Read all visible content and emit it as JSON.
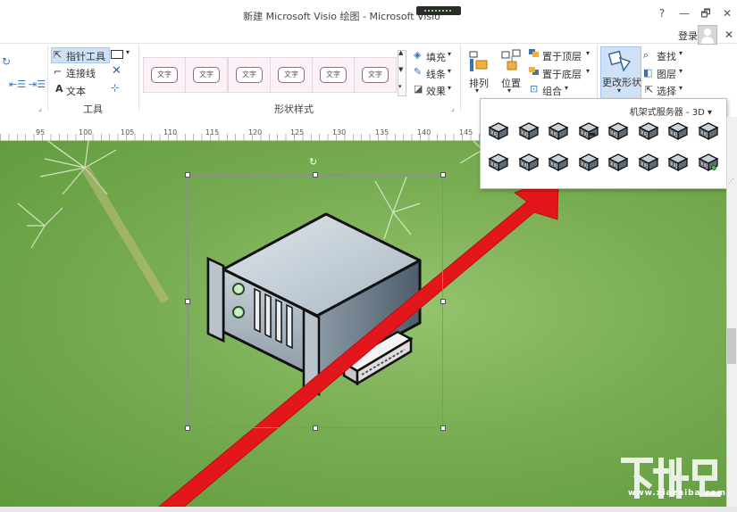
{
  "window": {
    "title": "新建 Microsoft Visio 绘图 - Microsoft Visio",
    "help": "?",
    "minimize": "—",
    "restore": "🗗",
    "close": "✕"
  },
  "account": {
    "login": "登录",
    "ribbon_close": "✕"
  },
  "tools_group": {
    "pointer": "指针工具",
    "connector": "连接线",
    "text": "文本",
    "label": "工具"
  },
  "shape_styles": {
    "label": "形状样式",
    "thumbnails": [
      "文字",
      "文字",
      "文字",
      "文字",
      "文字",
      "文字"
    ],
    "fill": "填充",
    "line": "线条",
    "effect": "效果"
  },
  "arrange": {
    "arrange": "排列",
    "position": "位置",
    "bring_front": "置于顶层",
    "send_back": "置于底层",
    "group": "组合"
  },
  "change_shape": {
    "label": "更改形状"
  },
  "editing": {
    "find": "查找",
    "layers": "图层",
    "select": "选择"
  },
  "ruler": {
    "labels": [
      "95",
      "100",
      "105",
      "110",
      "115",
      "120",
      "125",
      "130",
      "135",
      "140",
      "145"
    ]
  },
  "gallery": {
    "title": "机架式服务器 - 3D"
  },
  "watermark": {
    "text": "www.xiazaiba.com"
  },
  "colors": {
    "canvas": "#79ad53",
    "selected": "#cfe1f7",
    "arrow": "#e3171b"
  }
}
